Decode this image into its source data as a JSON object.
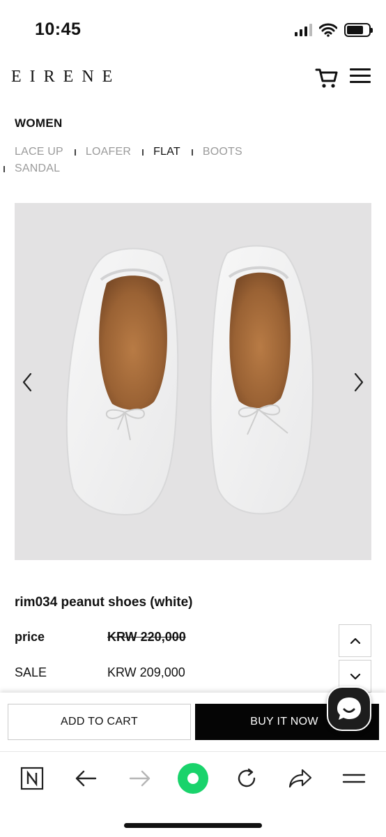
{
  "status_bar": {
    "time": "10:45",
    "icons": [
      "signal-icon",
      "wifi-icon",
      "battery-icon"
    ]
  },
  "header": {
    "brand": "EIRENE",
    "icons": [
      "cart-icon",
      "hamburger-menu-icon"
    ]
  },
  "category": {
    "title": "WOMEN",
    "subnav": [
      {
        "label": "LACE UP",
        "active": false
      },
      {
        "label": "LOAFER",
        "active": false
      },
      {
        "label": "FLAT",
        "active": true
      },
      {
        "label": "BOOTS",
        "active": false
      },
      {
        "label": "SANDAL",
        "active": false
      }
    ]
  },
  "gallery": {
    "background": "#e3e2e3",
    "icons": [
      "chevron-left-icon",
      "chevron-right-icon"
    ]
  },
  "product": {
    "name": "rim034 peanut shoes (white)",
    "price_label": "price",
    "price_value": "KRW 220,000",
    "sale_label": "SALE",
    "sale_value": "KRW 209,000"
  },
  "actions": {
    "add_to_cart": "ADD TO CART",
    "buy_now": "BUY IT NOW"
  },
  "browser_toolbar": {
    "icons": [
      "naver-n-icon",
      "back-arrow-icon",
      "forward-arrow-icon",
      "green-dot-icon",
      "refresh-icon",
      "share-icon",
      "menu-icon"
    ],
    "accent": "#19d36b"
  }
}
